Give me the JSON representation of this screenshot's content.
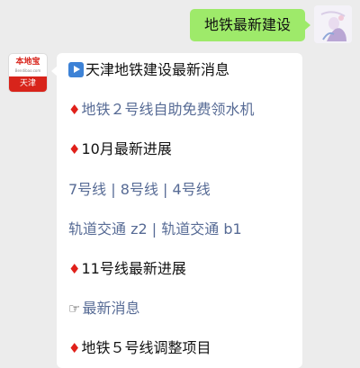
{
  "outgoing_message": {
    "text": "地铁最新建设"
  },
  "account": {
    "brand": "本地宝",
    "subtitle": "Bendibao.com",
    "city": "天津",
    "brand_color": "#d8241b"
  },
  "menu": {
    "header": {
      "icon": "play-button-icon",
      "text": "天津地铁建设最新消息"
    },
    "item_water": {
      "icon": "red-diamond-icon",
      "text": "地铁２号线自助免费领水机"
    },
    "item_oct": {
      "icon": "red-diamond-icon",
      "text": "10月最新进展"
    },
    "lines": [
      "7号线",
      "8号线",
      "4号线"
    ],
    "transits": [
      "轨道交通 z2",
      "轨道交通 b1"
    ],
    "item_line11": {
      "icon": "red-diamond-icon",
      "text": "11号线最新进展"
    },
    "item_news": {
      "icon": "pointing-hand-icon",
      "text": "最新消息"
    },
    "item_line5": {
      "icon": "red-diamond-icon",
      "text": "地铁５号线调整项目"
    },
    "separator": "|"
  },
  "colors": {
    "bubble": "#9eea6a",
    "link": "#576b95",
    "diamond": "#e0201a",
    "background": "#ececec"
  }
}
